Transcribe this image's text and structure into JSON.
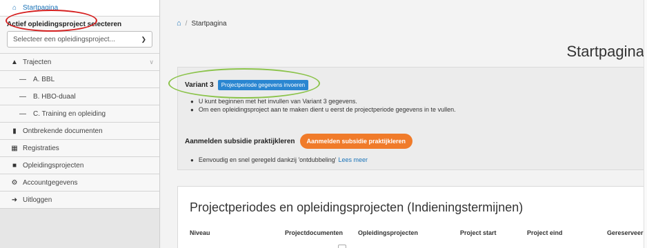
{
  "sidebar": {
    "home_label": "Startpagina",
    "project_label": "Actief opleidingsproject selecteren",
    "project_select_value": "Selecteer een opleidingsproject...",
    "trajecten_label": "Trajecten",
    "sub_items": [
      "A. BBL",
      "B. HBO-duaal",
      "C. Training en opleiding"
    ],
    "items": [
      {
        "label": "Ontbrekende documenten",
        "icon": "file-icon"
      },
      {
        "label": "Registraties",
        "icon": "table-icon"
      },
      {
        "label": "Opleidingsprojecten",
        "icon": "book-icon"
      },
      {
        "label": "Accountgegevens",
        "icon": "gears-icon"
      },
      {
        "label": "Uitloggen",
        "icon": "sign-out-icon"
      }
    ]
  },
  "breadcrumb": {
    "separator": "/",
    "current": "Startpagina"
  },
  "page_title": "Startpagina",
  "variant": {
    "label": "Variant 3",
    "button": "Projectperiode gegevens invoeren",
    "bullets": [
      "U kunt beginnen met het invullen van Variant 3 gegevens.",
      "Om een opleidingsproject aan te maken dient u eerst de projectperiode gegevens in te vullen."
    ]
  },
  "subsidie": {
    "label": "Aanmelden subsidie praktijkleren",
    "button": "Aanmelden subsidie praktijkleren",
    "bullet_text": "Eenvoudig en snel geregeld dankzij 'ontdubbeling'",
    "link": "Lees meer"
  },
  "table": {
    "title": "Projectperiodes en opleidingsprojecten (Indieningstermijnen)",
    "headers": [
      "Niveau",
      "Projectdocumenten",
      "Opleidingsprojecten",
      "Project start",
      "Project eind",
      "Gereserveer"
    ]
  },
  "colors": {
    "link": "#1a73b8",
    "primary_button": "#2a86d1",
    "orange_button": "#f07b2a",
    "annotation_red": "#d62020",
    "annotation_green": "#8bc34a"
  }
}
